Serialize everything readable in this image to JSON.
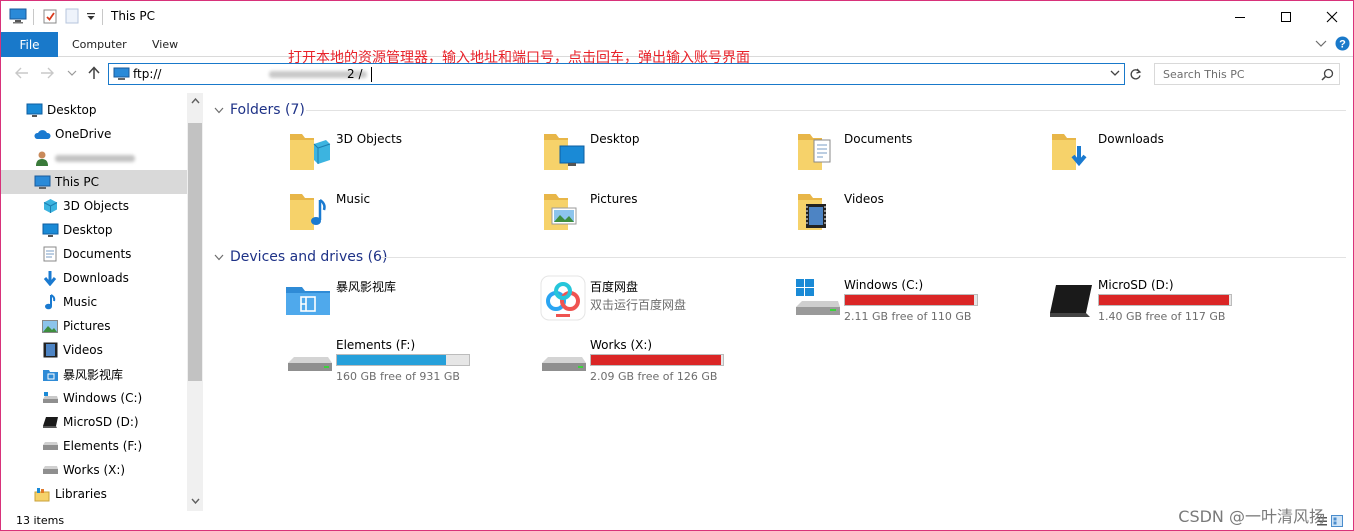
{
  "window": {
    "title": "This PC",
    "accent": "#1979ca"
  },
  "ribbon": {
    "file": "File",
    "tabs": [
      "Computer",
      "View"
    ]
  },
  "address": {
    "value_prefix": "ftp://",
    "value_suffix": "2  /",
    "search_placeholder": "Search This PC"
  },
  "annotation": "打开本地的资源管理器，输入地址和端口号，点击回车，弹出输入账号界面",
  "nav": {
    "items": [
      {
        "label": "Desktop",
        "icon": "desktop-icon"
      },
      {
        "label": "OneDrive",
        "icon": "onedrive-icon"
      },
      {
        "label": "",
        "icon": "user-icon"
      },
      {
        "label": "This PC",
        "icon": "this-pc-icon"
      },
      {
        "label": "3D Objects",
        "icon": "3d-objects-icon"
      },
      {
        "label": "Desktop",
        "icon": "desktop-folder-icon"
      },
      {
        "label": "Documents",
        "icon": "documents-icon"
      },
      {
        "label": "Downloads",
        "icon": "downloads-icon"
      },
      {
        "label": "Music",
        "icon": "music-icon"
      },
      {
        "label": "Pictures",
        "icon": "pictures-icon"
      },
      {
        "label": "Videos",
        "icon": "videos-icon"
      },
      {
        "label": "暴风影视库",
        "icon": "baofeng-icon"
      },
      {
        "label": "Windows (C:)",
        "icon": "windows-drive-icon"
      },
      {
        "label": "MicroSD (D:)",
        "icon": "microsd-icon"
      },
      {
        "label": "Elements (F:)",
        "icon": "hdd-icon"
      },
      {
        "label": "Works (X:)",
        "icon": "hdd-icon"
      },
      {
        "label": "Libraries",
        "icon": "libraries-icon"
      }
    ]
  },
  "folders": {
    "heading": "Folders (7)",
    "items": [
      {
        "label": "3D Objects",
        "icon": "3d-objects-folder-icon"
      },
      {
        "label": "Desktop",
        "icon": "desktop-folder-icon"
      },
      {
        "label": "Documents",
        "icon": "documents-folder-icon"
      },
      {
        "label": "Downloads",
        "icon": "downloads-folder-icon"
      },
      {
        "label": "Music",
        "icon": "music-folder-icon"
      },
      {
        "label": "Pictures",
        "icon": "pictures-folder-icon"
      },
      {
        "label": "Videos",
        "icon": "videos-folder-icon"
      }
    ]
  },
  "devices": {
    "heading": "Devices and drives (6)",
    "items": [
      {
        "name": "暴风影视库",
        "sub": "",
        "icon": "baofeng-app-icon"
      },
      {
        "name": "百度网盘",
        "sub": "双击运行百度网盘",
        "icon": "baidu-netdisk-icon"
      },
      {
        "name": "Windows (C:)",
        "free": "2.11 GB free of 110 GB",
        "used_fraction": 0.981,
        "bar_color": "#da2626",
        "icon": "windows-drive-icon"
      },
      {
        "name": "MicroSD (D:)",
        "free": "1.40 GB free of 117 GB",
        "used_fraction": 0.988,
        "bar_color": "#da2626",
        "icon": "microsd-drive-icon"
      },
      {
        "name": "Elements (F:)",
        "free": "160 GB free of 931 GB",
        "used_fraction": 0.828,
        "bar_color": "#26a0da",
        "icon": "hdd-icon"
      },
      {
        "name": "Works (X:)",
        "free": "2.09 GB free of 126 GB",
        "used_fraction": 0.983,
        "bar_color": "#da2626",
        "icon": "hdd-icon"
      }
    ]
  },
  "status": {
    "items": "13 items"
  },
  "watermark": "CSDN @一叶清风扬"
}
